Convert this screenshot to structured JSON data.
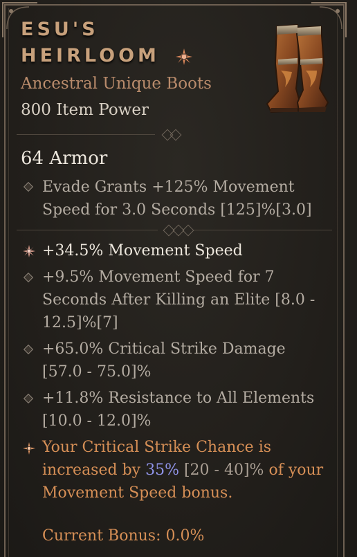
{
  "item": {
    "name_line1": "ESU'S",
    "name_line2": "HEIRLOOM",
    "rarity_type": "Ancestral Unique Boots",
    "item_power": "800 Item Power",
    "armor": "64 Armor",
    "implicit": "Evade Grants +125% Movement Speed for 3.0 Seconds [125]%[3.0]",
    "affixes": [
      "+34.5% Movement Speed",
      "+9.5% Movement Speed for 7 Seconds After Killing an Elite [8.0 - 12.5]%[7]",
      "+65.0% Critical Strike Damage [57.0 - 75.0]%",
      "+11.8% Resistance to All Elements [10.0 - 12.0]%"
    ],
    "unique_power": {
      "before": "Your Critical Strike Chance is increased by ",
      "value": "35%",
      "range": " [20 - 40]%",
      "after": " of your Movement Speed bonus."
    },
    "current_bonus": "Current Bonus: 0.0%"
  },
  "colors": {
    "unique_name": "#c8a17c",
    "unique_text": "#d68f56",
    "value_highlight": "#8f93e8",
    "affix_text": "#b4aca2"
  },
  "icons": [
    "unique-star-icon",
    "affix-diamond-icon",
    "greater-affix-icon",
    "boots-image"
  ]
}
